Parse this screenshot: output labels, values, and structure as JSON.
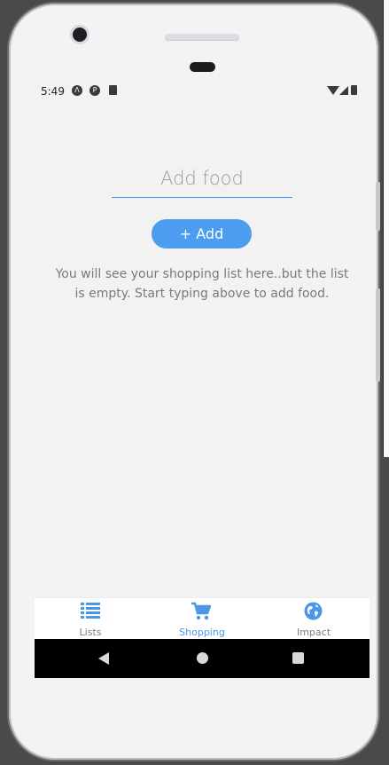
{
  "status_bar": {
    "time": "5:49",
    "icons": [
      "android-studio-icon",
      "record-icon",
      "sd-card-icon",
      "wifi-icon",
      "signal-icon",
      "battery-icon"
    ]
  },
  "main": {
    "input_placeholder": "Add food",
    "add_button_label": "+ Add",
    "empty_message": "You will see your shopping list here..but the list is empty. Start typing above to add food."
  },
  "tab_bar": {
    "active_tab": "Shopping",
    "tabs": [
      {
        "label": "Lists",
        "icon": "list-icon"
      },
      {
        "label": "Shopping",
        "icon": "cart-icon"
      },
      {
        "label": "Impact",
        "icon": "globe-icon"
      }
    ]
  },
  "nav_bar": {
    "buttons": [
      "back-icon",
      "home-icon",
      "recents-icon"
    ]
  },
  "colors": {
    "accent": "#4a97e8",
    "button": "#4c9cf0",
    "background": "#f2f2f3"
  }
}
